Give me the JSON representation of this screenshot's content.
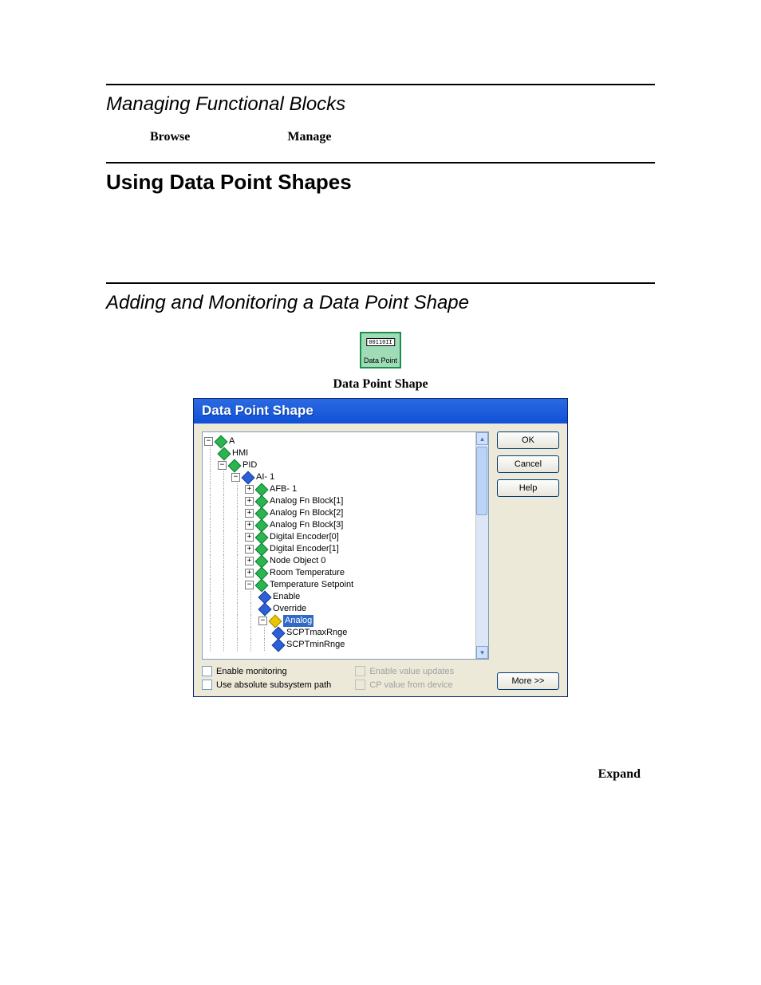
{
  "section1": {
    "title": "Managing Functional Blocks",
    "word1": "Browse",
    "word2": "Manage"
  },
  "section2": {
    "title": "Using Data Point Shapes"
  },
  "section3": {
    "title": "Adding and Monitoring a Data Point Shape"
  },
  "shape_icon": {
    "label": "Data Point",
    "caption": "Data Point Shape"
  },
  "dialog": {
    "title": "Data Point Shape",
    "buttons": {
      "ok": "OK",
      "cancel": "Cancel",
      "help": "Help",
      "more": "More >>"
    },
    "options": {
      "enable_monitoring": "Enable monitoring",
      "use_absolute_path": "Use absolute subsystem path",
      "enable_value_updates": "Enable value updates",
      "cp_value_from_device": "CP value from device"
    },
    "tree": {
      "root": "A",
      "hmi": "HMI",
      "pid": "PID",
      "ai1": "AI- 1",
      "items": [
        "AFB- 1",
        "Analog Fn Block[1]",
        "Analog Fn Block[2]",
        "Analog Fn Block[3]",
        "Digital Encoder[0]",
        "Digital Encoder[1]",
        "Node Object 0",
        "Room Temperature"
      ],
      "temp_setpoint": "Temperature Setpoint",
      "enable": "Enable",
      "override": "Override",
      "analog": "Analog",
      "scpt_max": "SCPTmaxRnge",
      "scpt_min": "SCPTminRnge"
    }
  },
  "footer_word": "Expand"
}
